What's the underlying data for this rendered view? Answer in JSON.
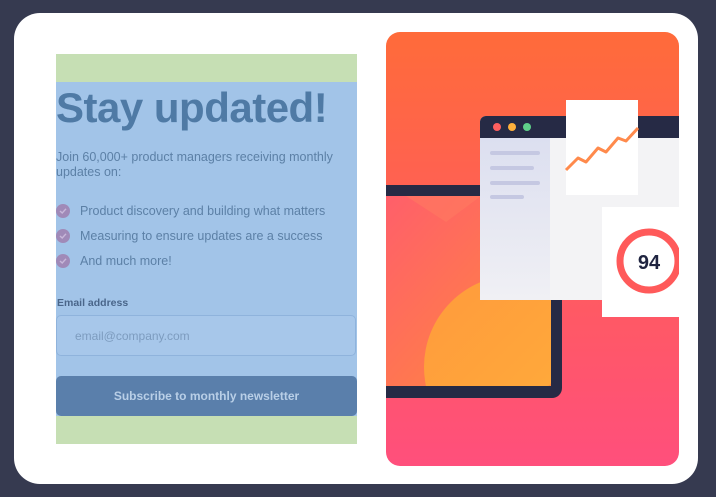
{
  "newsletter": {
    "title": "Stay updated!",
    "subtitle": "Join 60,000+ product managers receiving monthly updates on:",
    "features": [
      "Product discovery and building what matters",
      "Measuring to ensure updates are a success",
      "And much more!"
    ],
    "email_label": "Email address",
    "email_placeholder": "email@company.com",
    "submit_label": "Subscribe to monthly newsletter"
  },
  "illustration": {
    "score": "94"
  },
  "colors": {
    "page_background": "#363a50",
    "card": "#ffffff",
    "highlight_outer": "#c6dfb4",
    "highlight_inner": "#a2c4e8",
    "button": "#5a7fab",
    "gradient_top": "#ff6a3d",
    "gradient_bottom": "#ff4f7a"
  }
}
